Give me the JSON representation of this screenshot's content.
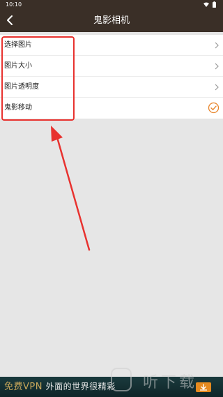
{
  "status_bar": {
    "time": "10:10"
  },
  "app_bar": {
    "title": "鬼影相机"
  },
  "menu": {
    "items": [
      {
        "label": "选择图片",
        "accessory": "chevron-right-icon"
      },
      {
        "label": "图片大小",
        "accessory": "chevron-right-icon"
      },
      {
        "label": "图片透明度",
        "accessory": "chevron-right-icon"
      },
      {
        "label": "鬼影移动",
        "accessory": "check-circle-icon",
        "checked": true
      }
    ]
  },
  "ad_banner": {
    "text_part1": "免费",
    "text_part2": "VPN",
    "text_part3": "外面的世界很精彩"
  },
  "watermark": {
    "text": "听下载"
  },
  "colors": {
    "app_bar": "#3a2f27",
    "accent": "#e8852b",
    "highlight": "#e8322f",
    "background": "#e6e6e6"
  }
}
